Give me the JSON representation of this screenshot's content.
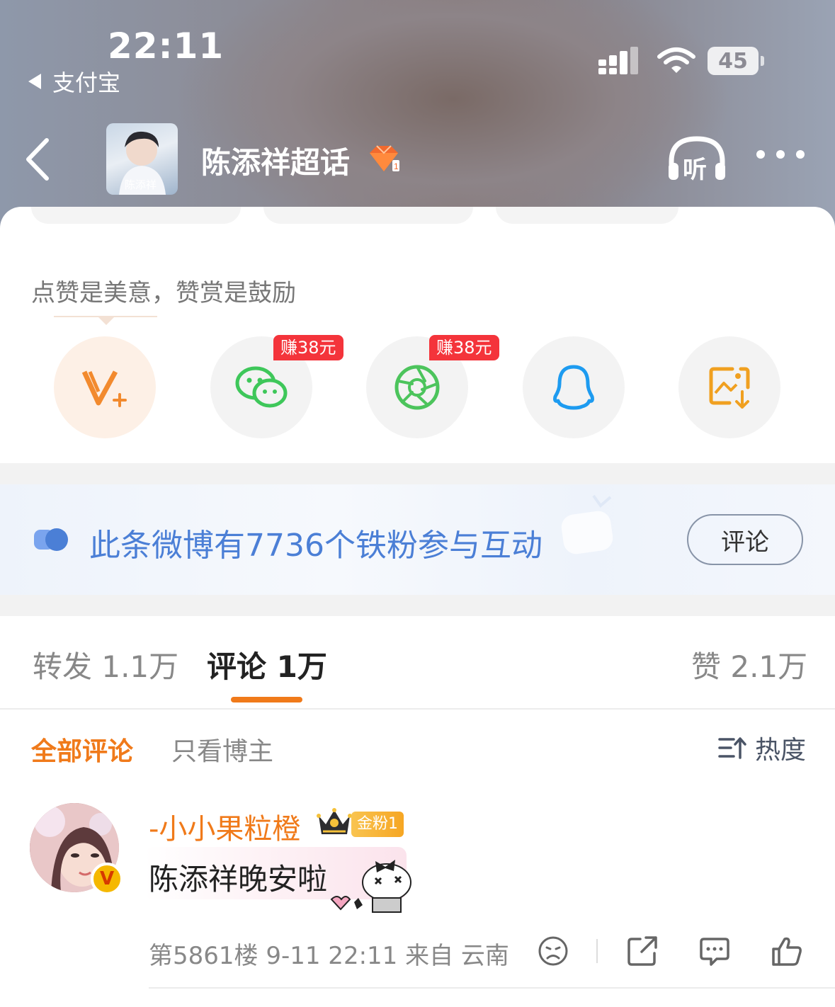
{
  "status_bar": {
    "time": "22:11",
    "back_app": "支付宝",
    "battery": "45"
  },
  "nav": {
    "title": "陈添祥超话",
    "avatar_caption": "陈添祥",
    "listen_label": "听"
  },
  "share": {
    "tip": "点赞是美意，赞赏是鼓励",
    "earn_badge_1": "赚38元",
    "earn_badge_2": "赚38元",
    "buttons": [
      "v-plus",
      "wechat",
      "moments",
      "qq",
      "save-image"
    ]
  },
  "fans_banner": {
    "text": "此条微博有7736个铁粉参与互动",
    "button": "评论",
    "accent": "#4b7fd6"
  },
  "tabs": {
    "repost": "转发 1.1万",
    "comment": "评论 1万",
    "like": "赞 2.1万",
    "accent": "#f07a1a"
  },
  "filters": {
    "all": "全部评论",
    "owner_only": "只看博主",
    "sort": "热度"
  },
  "comment": {
    "username": "-小小果粒橙",
    "fan_badge": "金粉1",
    "text": "陈添祥晚安啦",
    "meta": "第5861楼 9-11 22:11 来自 云南"
  }
}
